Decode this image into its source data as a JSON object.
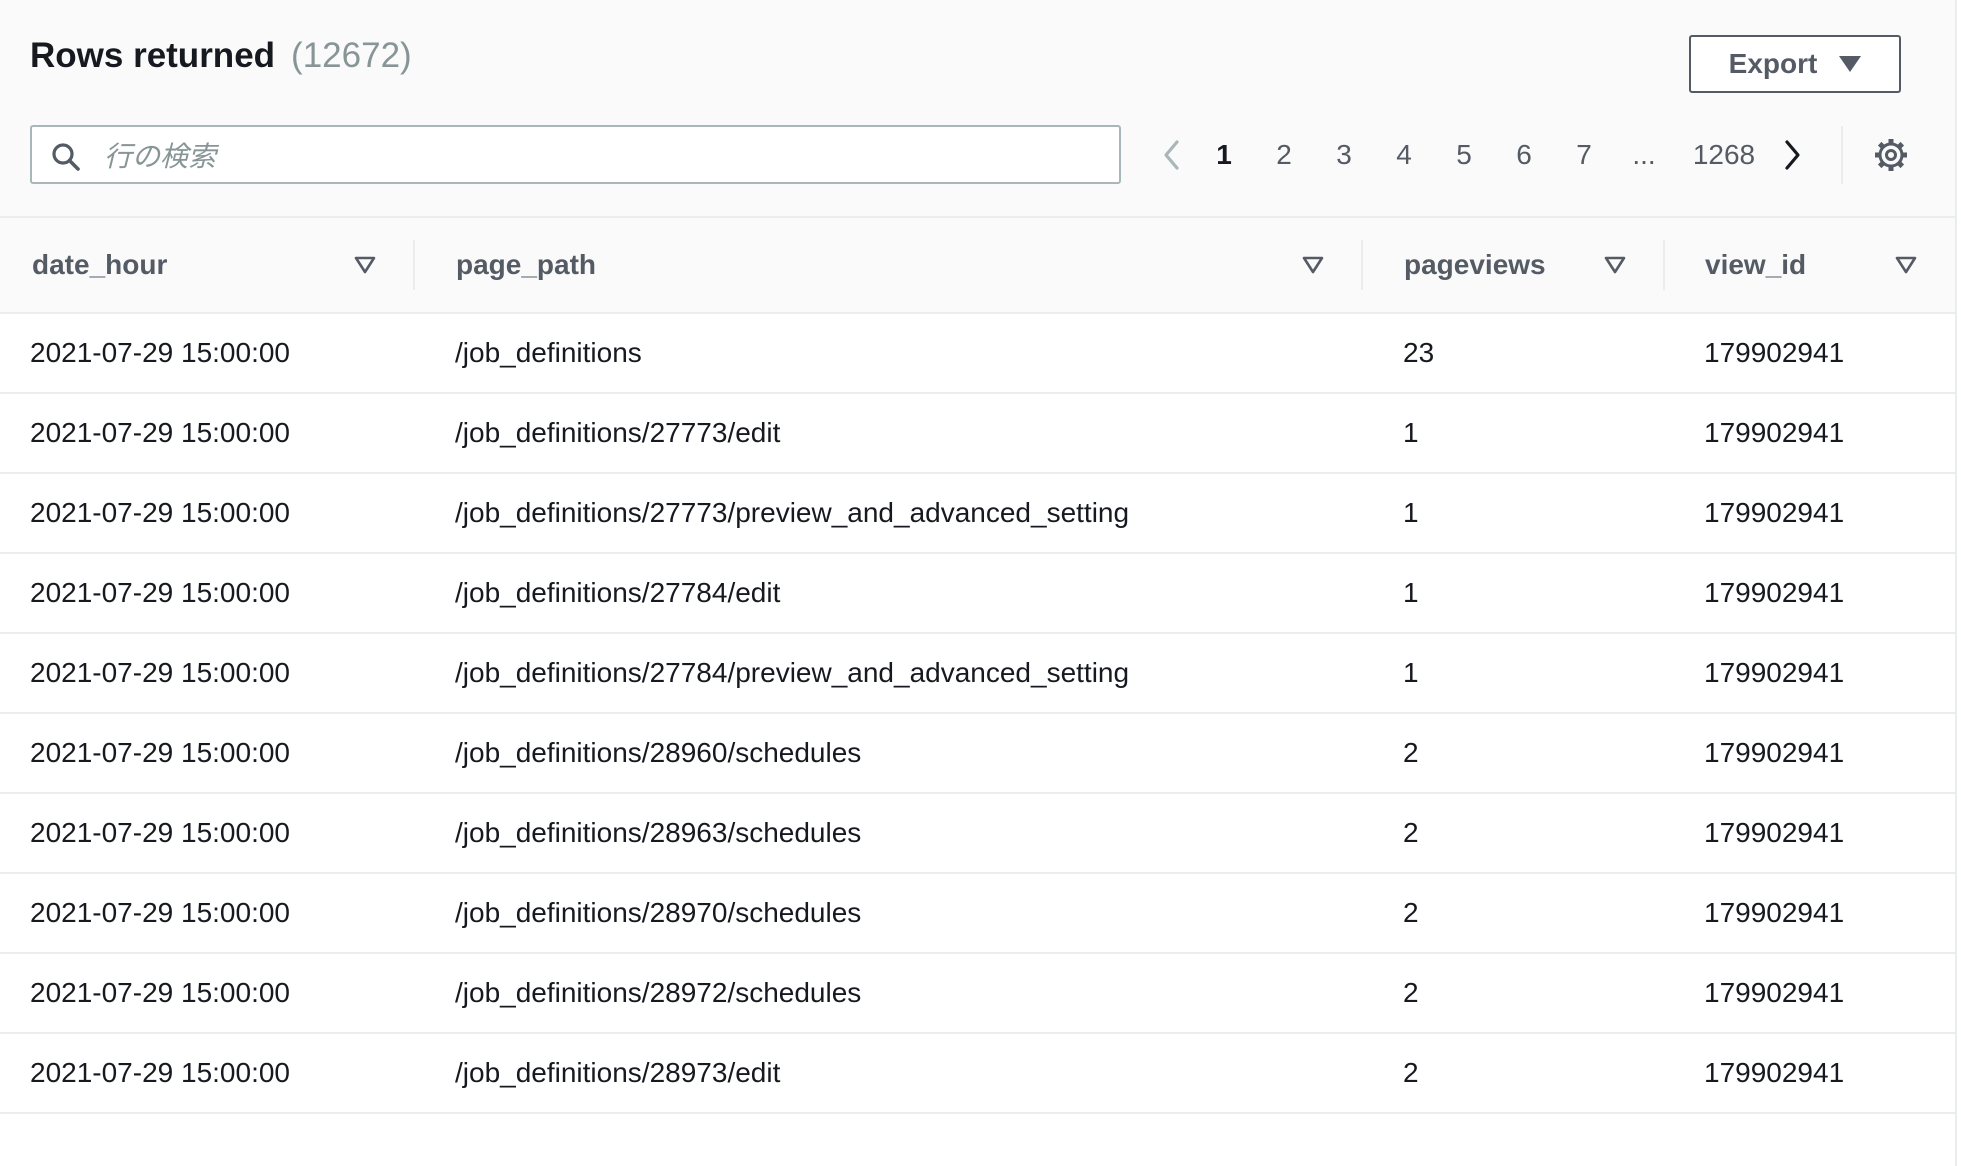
{
  "header": {
    "title": "Rows returned",
    "count": "(12672)",
    "export_label": "Export"
  },
  "search": {
    "placeholder": "行の検索",
    "value": ""
  },
  "pagination": {
    "pages": [
      "1",
      "2",
      "3",
      "4",
      "5",
      "6",
      "7"
    ],
    "current": "1",
    "ellipsis": "...",
    "last": "1268"
  },
  "table": {
    "columns": [
      "date_hour",
      "page_path",
      "pageviews",
      "view_id"
    ],
    "rows": [
      {
        "date_hour": "2021-07-29 15:00:00",
        "page_path": "/job_definitions",
        "pageviews": "23",
        "view_id": "179902941"
      },
      {
        "date_hour": "2021-07-29 15:00:00",
        "page_path": "/job_definitions/27773/edit",
        "pageviews": "1",
        "view_id": "179902941"
      },
      {
        "date_hour": "2021-07-29 15:00:00",
        "page_path": "/job_definitions/27773/preview_and_advanced_setting",
        "pageviews": "1",
        "view_id": "179902941"
      },
      {
        "date_hour": "2021-07-29 15:00:00",
        "page_path": "/job_definitions/27784/edit",
        "pageviews": "1",
        "view_id": "179902941"
      },
      {
        "date_hour": "2021-07-29 15:00:00",
        "page_path": "/job_definitions/27784/preview_and_advanced_setting",
        "pageviews": "1",
        "view_id": "179902941"
      },
      {
        "date_hour": "2021-07-29 15:00:00",
        "page_path": "/job_definitions/28960/schedules",
        "pageviews": "2",
        "view_id": "179902941"
      },
      {
        "date_hour": "2021-07-29 15:00:00",
        "page_path": "/job_definitions/28963/schedules",
        "pageviews": "2",
        "view_id": "179902941"
      },
      {
        "date_hour": "2021-07-29 15:00:00",
        "page_path": "/job_definitions/28970/schedules",
        "pageviews": "2",
        "view_id": "179902941"
      },
      {
        "date_hour": "2021-07-29 15:00:00",
        "page_path": "/job_definitions/28972/schedules",
        "pageviews": "2",
        "view_id": "179902941"
      },
      {
        "date_hour": "2021-07-29 15:00:00",
        "page_path": "/job_definitions/28973/edit",
        "pageviews": "2",
        "view_id": "179902941"
      }
    ]
  },
  "icons": {
    "search": "search-icon",
    "prev": "chevron-left-icon",
    "next": "chevron-right-icon",
    "settings": "gear-icon",
    "sort": "sort-triangle-icon",
    "export_caret": "caret-down-icon"
  },
  "colors": {
    "text": "#16191f",
    "secondary": "#545b64",
    "muted": "#879596",
    "border": "#aab7b8",
    "divider": "#eaeded"
  }
}
